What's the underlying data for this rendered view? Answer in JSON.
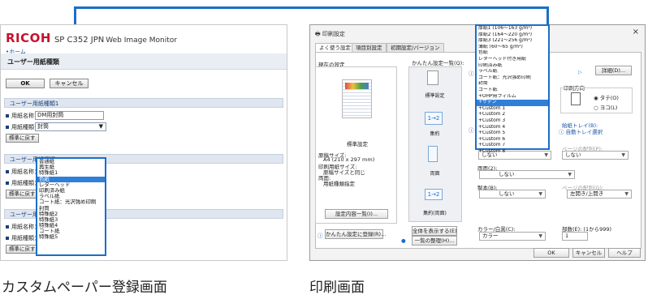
{
  "left": {
    "brand": "RICOH",
    "model": "SP C352 JPN",
    "app": "Web Image Monitor",
    "home_link": "•ホーム",
    "page_title": "ユーザー用紙種類",
    "ok": "OK",
    "cancel": "キャンセル",
    "section1": "ユーザー用紙種類1",
    "name_label": "用紙名称：",
    "name_value": "DM用封筒",
    "type_label": "用紙種類：",
    "type_value": "封筒",
    "reset": "標準に戻す",
    "section2": "ユーザー用紙種類2",
    "section3": "ユーザー用紙種類3",
    "dropdown_items": [
      "普通紙",
      "再生紙",
      "特殊紙1",
      "色紙",
      "レターヘッド",
      "印刷済み紙",
      "ラベル紙",
      "コート紙：光沢強め印刷",
      "封筒",
      "特殊紙2",
      "特殊紙3",
      "特殊紙4",
      "コート紙",
      "特殊紙5"
    ],
    "dropdown_selected": 3
  },
  "right": {
    "title": "印刷設定",
    "tabs": [
      "よく使う設定",
      "項目別設定",
      "初期設定/バージョン"
    ],
    "current_setting": "現在の設定",
    "quick_list_label": "かんたん設定一覧(Q):",
    "quick_items": [
      "標準設定",
      "集約",
      "両面",
      "集約(両面)"
    ],
    "quick_icon_text": "1→2",
    "preview_text": [
      "標準設定",
      "",
      "原稿サイズ:",
      "A4 (210 x 297 mm)",
      "印刷用紙サイズ:",
      "原稿サイズと同じ",
      "両面:",
      "用紙種類:",
      "用紙種類指定"
    ],
    "setting_list_button": "設定内容一覧(I)...",
    "register_button": "かんたん設定に登録(R)...",
    "show_all_button": "全体を表示する(E)",
    "manage_button": "一覧の整理(H)...",
    "detail_button": "詳細(D)...",
    "orientation_label": "印刷方向",
    "portrait": "タテ(O)",
    "landscape": "ヨコ(L)",
    "tray_label": "給紙トレイ(B):",
    "tray_value": "自動トレイ選択",
    "paper_type_value": "しない",
    "page_order_label": "ページの配列(P):",
    "page_order_value": "しない",
    "duplex_label": "両面(2):",
    "duplex_value": "しない",
    "booklet_label": "製本(B):",
    "booklet_value": "しない",
    "page_order2_label": "ページの配列(G):",
    "page_order2_value": "左開き/上開き",
    "color_label": "カラー/白黒(C):",
    "color_value": "カラー",
    "copies_label": "部数(E): (1から999)",
    "copies_value": "1",
    "ok": "OK",
    "cancel": "キャンセル",
    "help": "ヘルプ",
    "dropdown_items": [
      "厚紙1 (106〜163 g/m²)",
      "厚紙2 (164〜220 g/m²)",
      "厚紙3 (221〜256 g/m²)",
      "薄紙 (60〜65 g/m²)",
      "色紙",
      "レターヘッド付き用紙",
      "印刷済み紙",
      "ラベル紙",
      "コート紙：光沢強め印刷",
      "封筒",
      "コート紙",
      "+OHP用フィルム",
      "+サテン",
      "+Custom 1",
      "+Custom 2",
      "+Custom 3",
      "+Custom 4",
      "+Custom 5",
      "+Custom 6",
      "+Custom 7",
      "+Custom 8"
    ],
    "dropdown_selected": 12
  },
  "captions": {
    "left": "カスタムペーパー登録画面",
    "right": "印刷画面"
  },
  "colors": {
    "accent": "#1a6fc9",
    "ricoh_red": "#c8102e",
    "highlight": "#2f7fd8"
  }
}
